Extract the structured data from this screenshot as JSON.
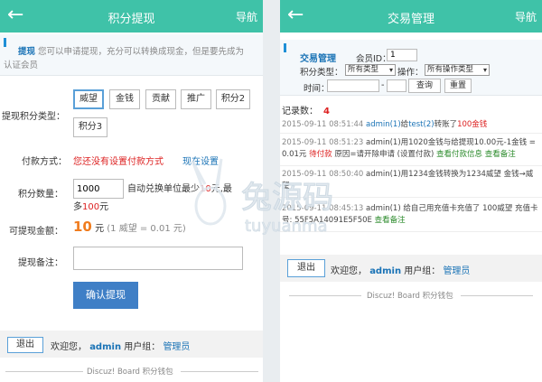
{
  "left": {
    "header": {
      "back_icon": "back-arrow-icon",
      "title": "积分提现",
      "nav": "导航"
    },
    "notice": {
      "title": "提现",
      "text_line1": "您可以申请提现，充分可以转换成现金，但是要先成为",
      "text_line2": "认证会员"
    },
    "type_label": "提现积分类型：",
    "type_options": [
      "威望",
      "金钱",
      "贡献",
      "推广",
      "积分2",
      "积分3"
    ],
    "selected_type": "威望",
    "payment_label": "付款方式：",
    "payment_text": "您还没有设置付款方式",
    "payment_link": "现在设置",
    "amount_label": "积分数量：",
    "amount_value": "1000",
    "amount_hint_a": "自动兑换单位最少",
    "amount_min": "10",
    "amount_hint_b": "元,最",
    "amount_hint_c": "多",
    "amount_max": "100",
    "amount_hint_d": "元",
    "cash_label": "可提现金额：",
    "cash_value": "10",
    "cash_unit": "元",
    "cash_rate": "(1 威望 = 0.01 元)",
    "remark_label": "提现备注：",
    "remark_value": "",
    "submit": "确认提现",
    "footer": {
      "logout": "退出",
      "welcome": "欢迎您，",
      "user": "admin",
      "group_label": "用户组：",
      "group": "管理员"
    },
    "copyright": "Discuz! Board 积分钱包"
  },
  "right": {
    "header": {
      "back_icon": "back-arrow-icon",
      "title": "交易管理",
      "nav": "导航"
    },
    "filter": {
      "title": "交易管理",
      "member_label": "会员ID：",
      "member_value": "1",
      "type_label": "积分类型：",
      "type_value": "所有类型",
      "op_label": "操作：",
      "op_value": "所有操作类型",
      "time_label": "时间：",
      "time_from": "",
      "time_sep": "-",
      "time_to": "",
      "query_btn": "查询",
      "reset_btn": "重置"
    },
    "records_label": "记录数：",
    "records_count": "4",
    "records": [
      {
        "time": "2015-09-11 08:51:44",
        "user": "admin(1)",
        "action": "给",
        "target": "test(2)",
        "verb": "转账了",
        "amount": "100金钱"
      },
      {
        "time": "2015-09-11 08:51:23",
        "line1": "admin(1)用1020金钱与给提现10.00元-1金钱 =",
        "line2": "0.01元",
        "status": "待付款",
        "detail": "原因=请开除申请 (设置付款)",
        "link1": "查看付款信息",
        "link2": "查看备注"
      },
      {
        "time": "2015-09-11 08:50:40",
        "line1": "admin(1)用1234金钱转换为1234威望 金钱→威",
        "line2": "望"
      },
      {
        "time": "2015-09-11 08:45:13",
        "line1": "admin(1) 给自己用充值卡充值了 100威望 充值卡",
        "line2": "号: 55F5A14091E5F50E",
        "link1": "查看备注"
      }
    ],
    "footer": {
      "logout": "退出",
      "welcome": "欢迎您，",
      "user": "admin",
      "group_label": "用户组：",
      "group": "管理员"
    },
    "copyright": "Discuz! Board 积分钱包"
  },
  "watermark": {
    "cn": "兔源码",
    "en": "tuyuanma"
  }
}
